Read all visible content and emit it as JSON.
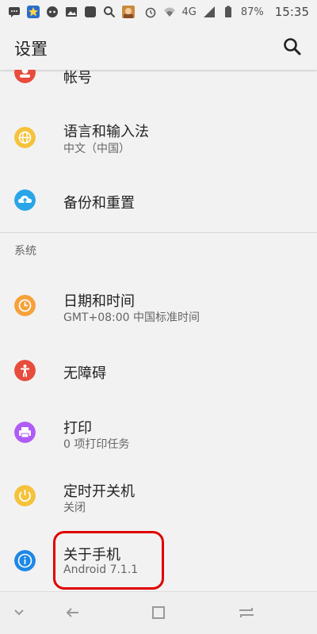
{
  "status": {
    "network": "4G",
    "battery": "87%",
    "time": "15:35"
  },
  "header": {
    "title": "设置"
  },
  "items_top": [
    {
      "title": "帐号"
    },
    {
      "title": "语言和输入法",
      "subtitle": "中文（中国）"
    },
    {
      "title": "备份和重置"
    }
  ],
  "section": {
    "title": "系统"
  },
  "items_system": [
    {
      "title": "日期和时间",
      "subtitle": "GMT+08:00 中国标准时间"
    },
    {
      "title": "无障碍"
    },
    {
      "title": "打印",
      "subtitle": "0 项打印任务"
    },
    {
      "title": "定时开关机",
      "subtitle": "关闭"
    },
    {
      "title": "关于手机",
      "subtitle": "Android 7.1.1"
    }
  ],
  "colors": {
    "accent_red": "#e00000",
    "icon_yellow": "#f5c33b",
    "icon_blue": "#2aa6e8",
    "icon_orange": "#f6a13a",
    "icon_red": "#e74c3c",
    "icon_purple": "#b05cf6",
    "icon_info_blue": "#1e88e5"
  },
  "icons": {
    "status_left": [
      "messages-icon",
      "star-icon",
      "cat-icon",
      "image-icon",
      "square-icon",
      "search-icon",
      "game-avatar-icon"
    ],
    "status_right": [
      "alarm-icon",
      "wifi-icon",
      "signal-icon",
      "battery-icon"
    ],
    "nav": [
      "chevron-down-icon",
      "back-icon",
      "home-icon",
      "recents-icon"
    ]
  }
}
